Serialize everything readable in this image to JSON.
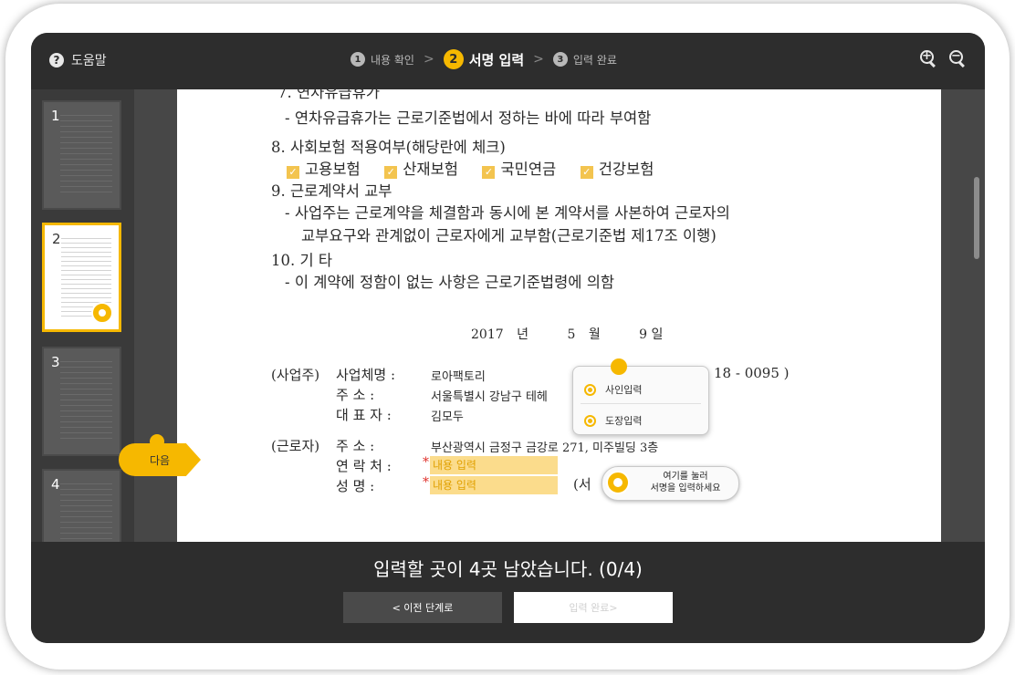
{
  "topbar": {
    "help_label": "도움말",
    "help_icon": "?",
    "steps": [
      {
        "num": "1",
        "label": "내용 확인"
      },
      {
        "num": "2",
        "label": "서명 입력"
      },
      {
        "num": "3",
        "label": "입력 완료"
      }
    ],
    "separator": ">",
    "zoom_in": "+",
    "zoom_out": "−"
  },
  "thumbnails": [
    "1",
    "2",
    "3",
    "4"
  ],
  "next_tab": "다음",
  "document": {
    "header_partial": "7. 연차유급휴가",
    "leave_text": "- 연차유급휴가는 근로기준법에서 정하는 바에 따라 부여함",
    "insurance_title": "8. 사회보험 적용여부(해당란에 체크)",
    "insurance_items": [
      "고용보험",
      "산재보험",
      "국민연금",
      "건강보험"
    ],
    "contract_title": "9. 근로계약서 교부",
    "contract_line1": "- 사업주는 근로계약을 체결함과 동시에 본 계약서를 사본하여 근로자의",
    "contract_line2": "교부요구와 관계없이 근로자에게 교부함(근로기준법 제17조 이행)",
    "etc_title": "10. 기   타",
    "etc_line": "- 이 계약에 정함이 없는 사항은 근로기준법령에 의함",
    "date": {
      "year": "2017",
      "year_unit": "년",
      "month": "5",
      "month_unit": "월",
      "day": "9",
      "day_unit": "일"
    },
    "employer_label": "(사업주)",
    "employer_rows": [
      {
        "label": "사업체명 :",
        "value": "로아팩토리"
      },
      {
        "label": "주      소 :",
        "value": "서울특별시 강남구 테헤"
      },
      {
        "label": "대 표 자 :",
        "value": "김모두"
      }
    ],
    "employer_phone_tail": "18 - 0095  )",
    "employee_label": "(근로자)",
    "employee_address_label": "주      소 :",
    "employee_address": "부산광역시 금정구 금강로 271, 미주빌딩 3층",
    "employee_contact_label": "연 락 처 :",
    "employee_name_label": "성      명 :",
    "required_mark": "*",
    "field_placeholder": "내용 입력",
    "signature_partial": "(서"
  },
  "popup": {
    "items": [
      "사인입력",
      "도장입력"
    ]
  },
  "signature_hint": {
    "line1": "여기를 눌러",
    "line2": "서명을 입력하세요"
  },
  "bottom": {
    "message": "입력할 곳이 4곳 남았습니다. (0/4)",
    "prev_button": "< 이전 단계로",
    "done_button": "입력 완료>"
  },
  "colors": {
    "accent": "#f6b800",
    "field_fill": "#fbdc8c",
    "dark_bar": "#2d2d2d"
  }
}
